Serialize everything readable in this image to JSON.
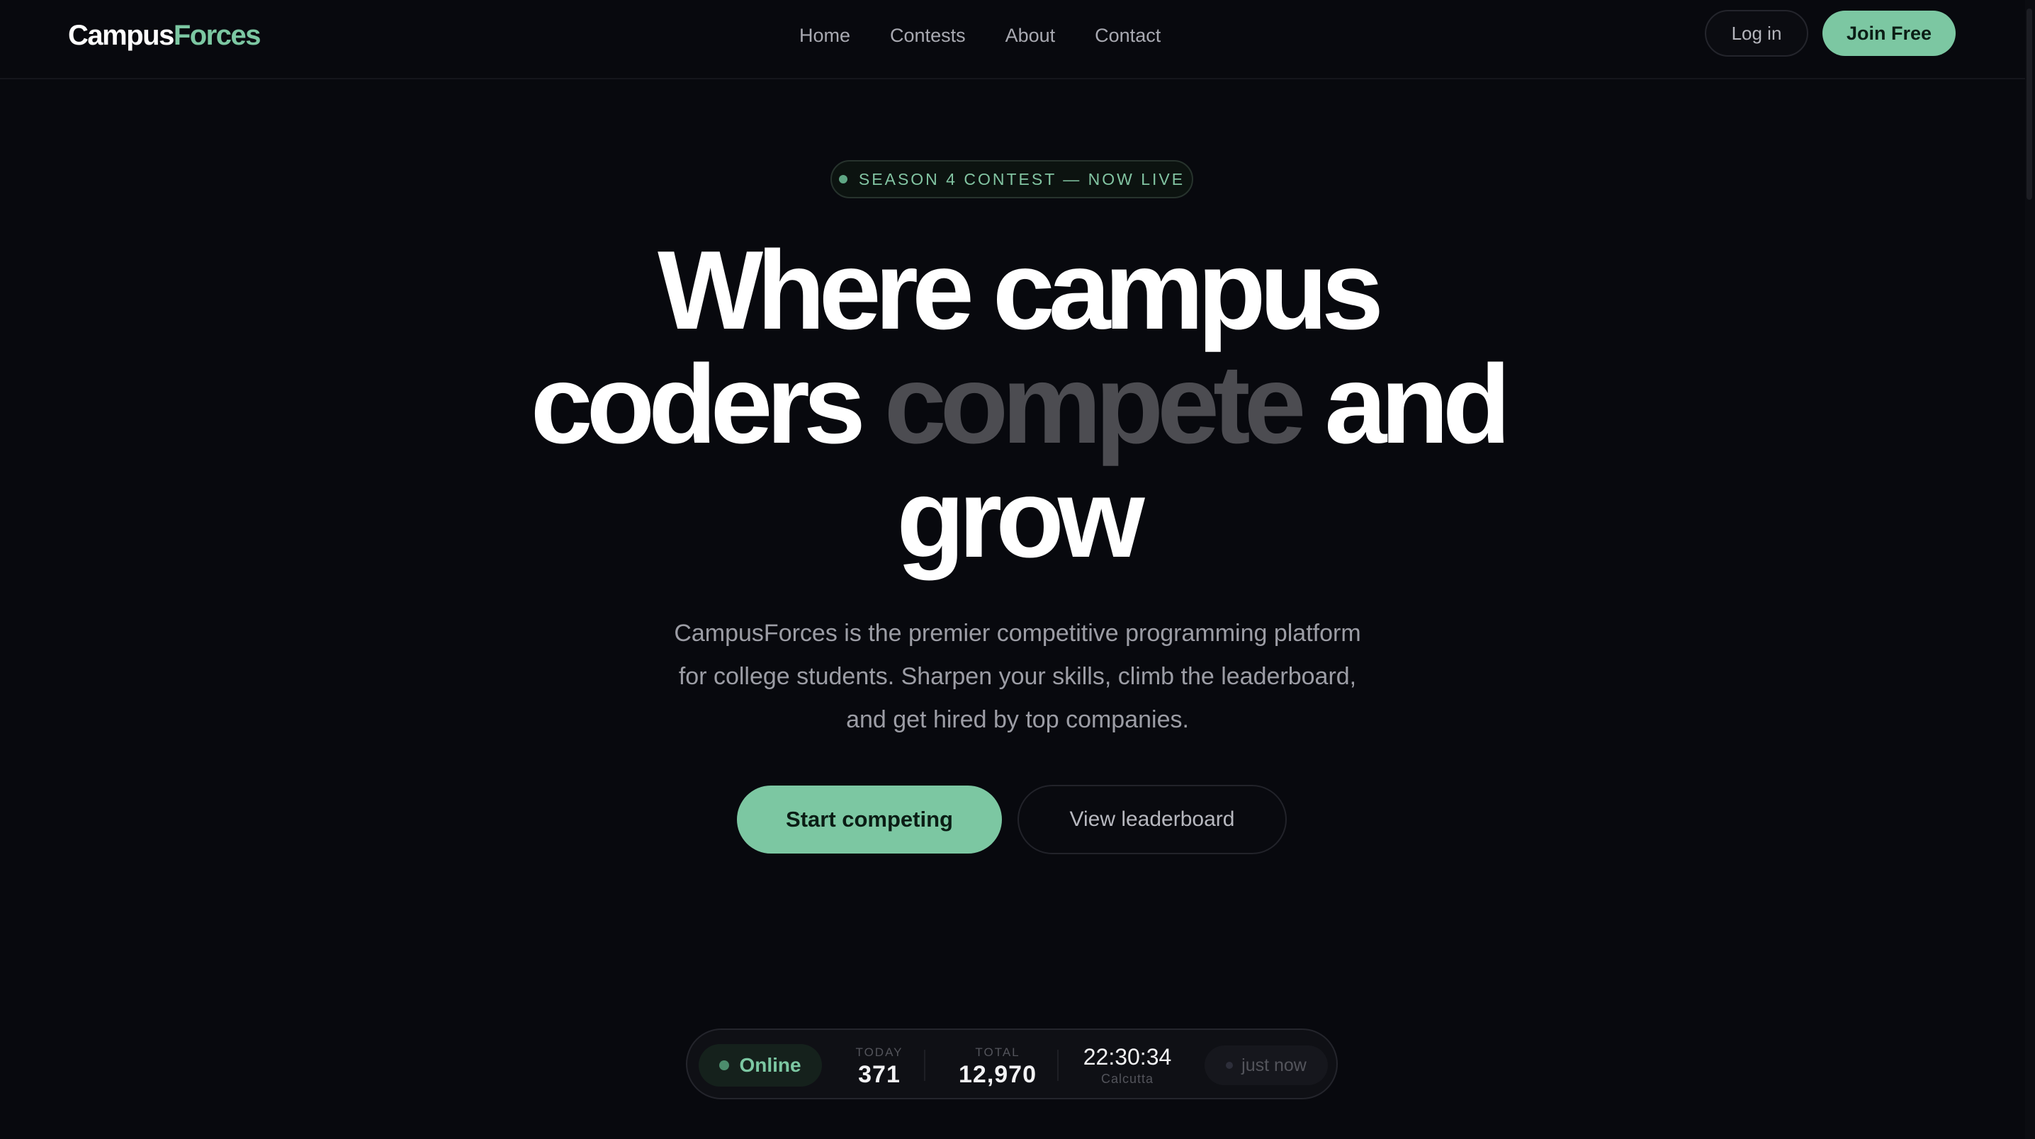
{
  "brand": {
    "part1": "Campus",
    "part2": "Forces"
  },
  "nav": {
    "links": [
      "Home",
      "Contests",
      "About",
      "Contact"
    ],
    "login_label": "Log in",
    "join_label": "Join Free"
  },
  "hero": {
    "badge": "SEASON 4 CONTEST — NOW LIVE",
    "headline": {
      "line1": "Where campus",
      "line2_pre": "coders ",
      "line2_dim": "compete",
      "line2_post": " and",
      "line3": "grow"
    },
    "subtext": {
      "line1": "CampusForces is the premier competitive programming platform",
      "line2": "for college students. Sharpen your skills, climb the leaderboard,",
      "line3": "and get hired by top companies."
    },
    "cta_primary": "Start competing",
    "cta_secondary": "View leaderboard"
  },
  "stats": {
    "status": "Online",
    "today_label": "TODAY",
    "today_value": "371",
    "total_label": "TOTAL",
    "total_value": "12,970",
    "clock_time": "22:30:34",
    "clock_zone": "Calcutta",
    "updated": "just now"
  },
  "colors": {
    "background": "#08090e",
    "accent": "#7cc7a2",
    "dim_text": "#4c4c51"
  }
}
